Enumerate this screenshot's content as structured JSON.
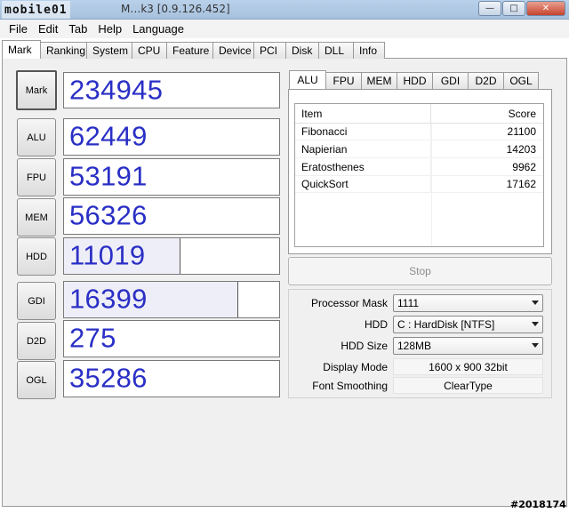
{
  "window": {
    "logo": "mobile01",
    "title": "M…k3 [0.9.126.452]",
    "min_icon": "minimize-icon",
    "max_icon": "maximize-icon",
    "close_icon": "close-icon"
  },
  "menu": [
    "File",
    "Edit",
    "Tab",
    "Help",
    "Language"
  ],
  "main_tabs": [
    "Mark",
    "Ranking",
    "System",
    "CPU",
    "Feature",
    "Device",
    "PCI",
    "Disk",
    "DLL",
    "Info"
  ],
  "active_main_tab": "Mark",
  "scores": [
    {
      "label": "Mark",
      "value": "234945"
    },
    {
      "label": "ALU",
      "value": "62449"
    },
    {
      "label": "FPU",
      "value": "53191"
    },
    {
      "label": "MEM",
      "value": "56326"
    },
    {
      "label": "HDD",
      "value": "11019",
      "bar_fraction": 0.54
    },
    {
      "label": "GDI",
      "value": "16399",
      "bar_fraction": 0.81
    },
    {
      "label": "D2D",
      "value": "275"
    },
    {
      "label": "OGL",
      "value": "35286"
    }
  ],
  "sub_tabs": [
    "ALU",
    "FPU",
    "MEM",
    "HDD",
    "GDI",
    "D2D",
    "OGL"
  ],
  "active_sub_tab": "ALU",
  "result_table": {
    "headers": {
      "item": "Item",
      "score": "Score"
    },
    "rows": [
      {
        "item": "Fibonacci",
        "score": "21100"
      },
      {
        "item": "Napierian",
        "score": "14203"
      },
      {
        "item": "Eratosthenes",
        "score": "9962"
      },
      {
        "item": "QuickSort",
        "score": "17162"
      }
    ]
  },
  "stop_label": "Stop",
  "settings": {
    "processor_mask": {
      "label": "Processor Mask",
      "value": "1111"
    },
    "hdd": {
      "label": "HDD",
      "value": "C : HardDisk [NTFS]"
    },
    "hdd_size": {
      "label": "HDD Size",
      "value": "128MB"
    },
    "display_mode": {
      "label": "Display Mode",
      "value": "1600 x 900 32bit"
    },
    "font_smoothing": {
      "label": "Font Smoothing",
      "value": "ClearType"
    }
  },
  "watermark": "#2018174"
}
